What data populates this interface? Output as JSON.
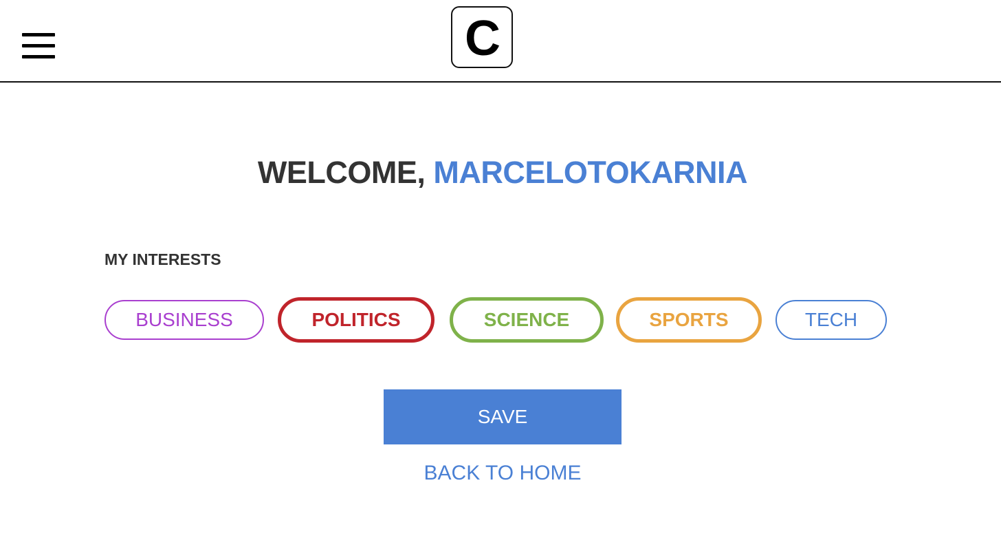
{
  "header": {
    "menu_icon": "hamburger-menu-icon",
    "logo_letter": "C"
  },
  "welcome": {
    "greeting": "WELCOME, ",
    "username": "MARCELOTOKARNIA"
  },
  "interests": {
    "title": "MY INTERESTS",
    "chips": [
      {
        "label": "BUSINESS",
        "selected": false,
        "color": "#a93fcf"
      },
      {
        "label": "POLITICS",
        "selected": true,
        "color": "#c0242b"
      },
      {
        "label": "SCIENCE",
        "selected": true,
        "color": "#7fb24a"
      },
      {
        "label": "SPORTS",
        "selected": true,
        "color": "#e9a440"
      },
      {
        "label": "TECH",
        "selected": false,
        "color": "#4a80d4"
      }
    ]
  },
  "actions": {
    "save_label": "SAVE",
    "back_label": "BACK TO HOME"
  },
  "colors": {
    "accent": "#4a80d4",
    "text": "#333333"
  }
}
